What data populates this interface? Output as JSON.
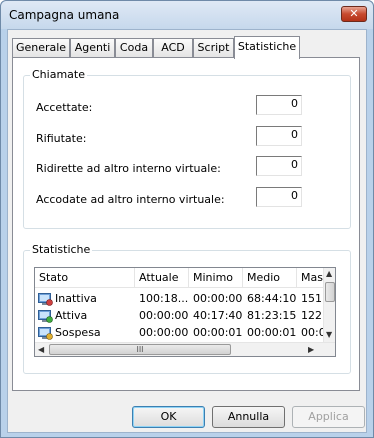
{
  "window": {
    "title": "Campagna umana",
    "close_glyph": "✕"
  },
  "tabs": [
    {
      "label": "Generale"
    },
    {
      "label": "Agenti"
    },
    {
      "label": "Coda"
    },
    {
      "label": "ACD"
    },
    {
      "label": "Script"
    },
    {
      "label": "Statistiche",
      "active": true
    }
  ],
  "chiamate": {
    "title": "Chiamate",
    "fields": [
      {
        "label": "Accettate:",
        "value": "0"
      },
      {
        "label": "Rifiutate:",
        "value": "0"
      },
      {
        "label": "Ridirette ad altro interno virtuale:",
        "value": "0"
      },
      {
        "label": "Accodate ad altro interno virtuale:",
        "value": "0"
      }
    ]
  },
  "statistiche": {
    "title": "Statistiche",
    "columns": [
      "Stato",
      "Attuale",
      "Minimo",
      "Medio",
      "Mas"
    ],
    "rows": [
      {
        "icon": "monitor-status-icon",
        "stato": "Inattiva",
        "attuale": "100:18...",
        "minimo": "00:00:00",
        "medio": "68:44:10",
        "mas": "151"
      },
      {
        "icon": "monitor-status-icon",
        "stato": "Attiva",
        "attuale": "00:00:00",
        "minimo": "40:17:40",
        "medio": "81:23:15",
        "mas": "122"
      },
      {
        "icon": "monitor-status-icon",
        "stato": "Sospesa",
        "attuale": "00:00:00",
        "minimo": "00:00:01",
        "medio": "00:00:01",
        "mas": "00:0"
      }
    ],
    "hscroll_grip": "III"
  },
  "buttons": {
    "ok": "OK",
    "cancel": "Annulla",
    "apply": "Applica"
  },
  "colors": {
    "close_button": "#c74a2f",
    "default_button_border": "#3c7fb1"
  }
}
